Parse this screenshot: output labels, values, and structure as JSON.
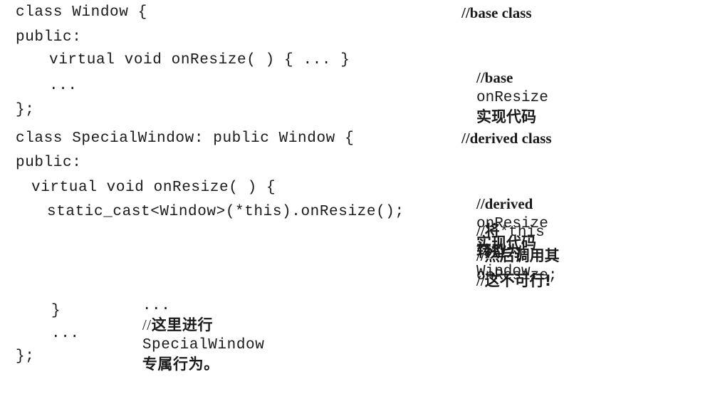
{
  "code_lines": [
    "class Window {",
    "public:",
    "virtual void onResize( ) { ... }",
    "...",
    "};",
    "class SpecialWindow: public Window {",
    "public:",
    "virtual void onResize( ) {",
    "static_cast<Window>(*this).onResize();",
    "...",
    "}",
    "...",
    "};"
  ],
  "inline_comment_line10": {
    "prefix": "//",
    "cjk1": "这里进行",
    "mono": "SpecialWindow",
    "cjk2": "专属行为。"
  },
  "comments": {
    "c1": "//base class",
    "c2_prefix": "//base",
    "c2_mono": "onResize",
    "c2_cjk": "实现代码",
    "c3": "//derived class",
    "c4_prefix": "//derived",
    "c4_mono": "onResize",
    "c4_cjk": "实现代码",
    "c5_prefix": "//",
    "c5_cjk1": "将",
    "c5_mono1": "*this",
    "c5_cjk2": "转型为",
    "c5_mono2": "Window,",
    "c6_prefix": "//",
    "c6_cjk": "然后调用其",
    "c6_mono": "onResize;",
    "c7_prefix": "//",
    "c7_cjk": "这不可行!"
  }
}
